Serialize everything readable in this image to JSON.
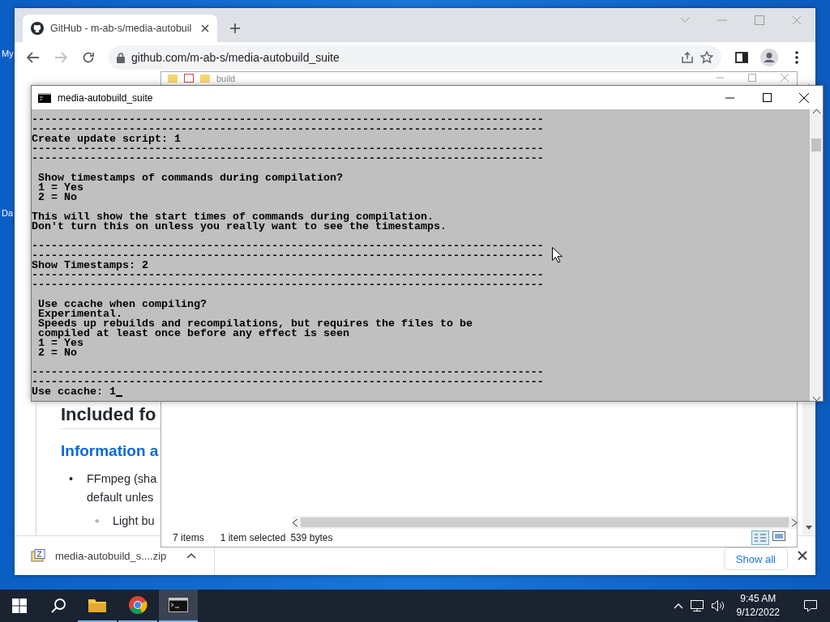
{
  "desktop": {
    "icon_labels": [
      "My",
      "Da"
    ]
  },
  "browser": {
    "tab": {
      "title": "GitHub - m-ab-s/media-autobuil",
      "selected": true
    },
    "forward_disabled": true,
    "url": "github.com/m-ab-s/media-autobuild_suite",
    "page": {
      "heading": "Included fo",
      "subheading": "Information a",
      "bullets": [
        {
          "marker": "•",
          "lines": [
            "FFmpeg (sha",
            "default unles"
          ]
        }
      ],
      "sub_bullets": [
        {
          "marker": "◦",
          "lines": [
            "Light bu"
          ]
        }
      ]
    },
    "download": {
      "file": "media-autobuild_s....zip",
      "show_all": "Show all"
    }
  },
  "explorer": {
    "title": "build",
    "status": {
      "items": "7 items",
      "selected": "1 item selected",
      "size": "539 bytes"
    }
  },
  "console": {
    "title": "media-autobuild_suite",
    "blocks": [
      {
        "lines": [
          "-------------------------------------------------------------------------------",
          "-------------------------------------------------------------------------------",
          "Create update script: 1",
          "-------------------------------------------------------------------------------",
          "-------------------------------------------------------------------------------"
        ]
      },
      {
        "lines": [
          " Show timestamps of commands during compilation?",
          " 1 = Yes",
          " 2 = No"
        ]
      },
      {
        "lines": [
          "This will show the start times of commands during compilation.",
          "Don't turn this on unless you really want to see the timestamps."
        ]
      },
      {
        "lines": [
          "-------------------------------------------------------------------------------",
          "-------------------------------------------------------------------------------",
          "Show Timestamps: 2",
          "-------------------------------------------------------------------------------",
          "-------------------------------------------------------------------------------"
        ]
      },
      {
        "lines": [
          " Use ccache when compiling?",
          " Experimental.",
          " Speeds up rebuilds and recompilations, but requires the files to be",
          " compiled at least once before any effect is seen",
          " 1 = Yes",
          " 2 = No"
        ]
      },
      {
        "lines": [
          "-------------------------------------------------------------------------------",
          "-------------------------------------------------------------------------------",
          "Use ccache: 1"
        ]
      }
    ]
  },
  "taskbar": {
    "apps": [
      {
        "kind": "folder",
        "selected": false
      },
      {
        "kind": "browser",
        "selected": false
      },
      {
        "kind": "terminal",
        "selected": true
      }
    ],
    "time": "9:45 AM",
    "date": "9/12/2022"
  }
}
